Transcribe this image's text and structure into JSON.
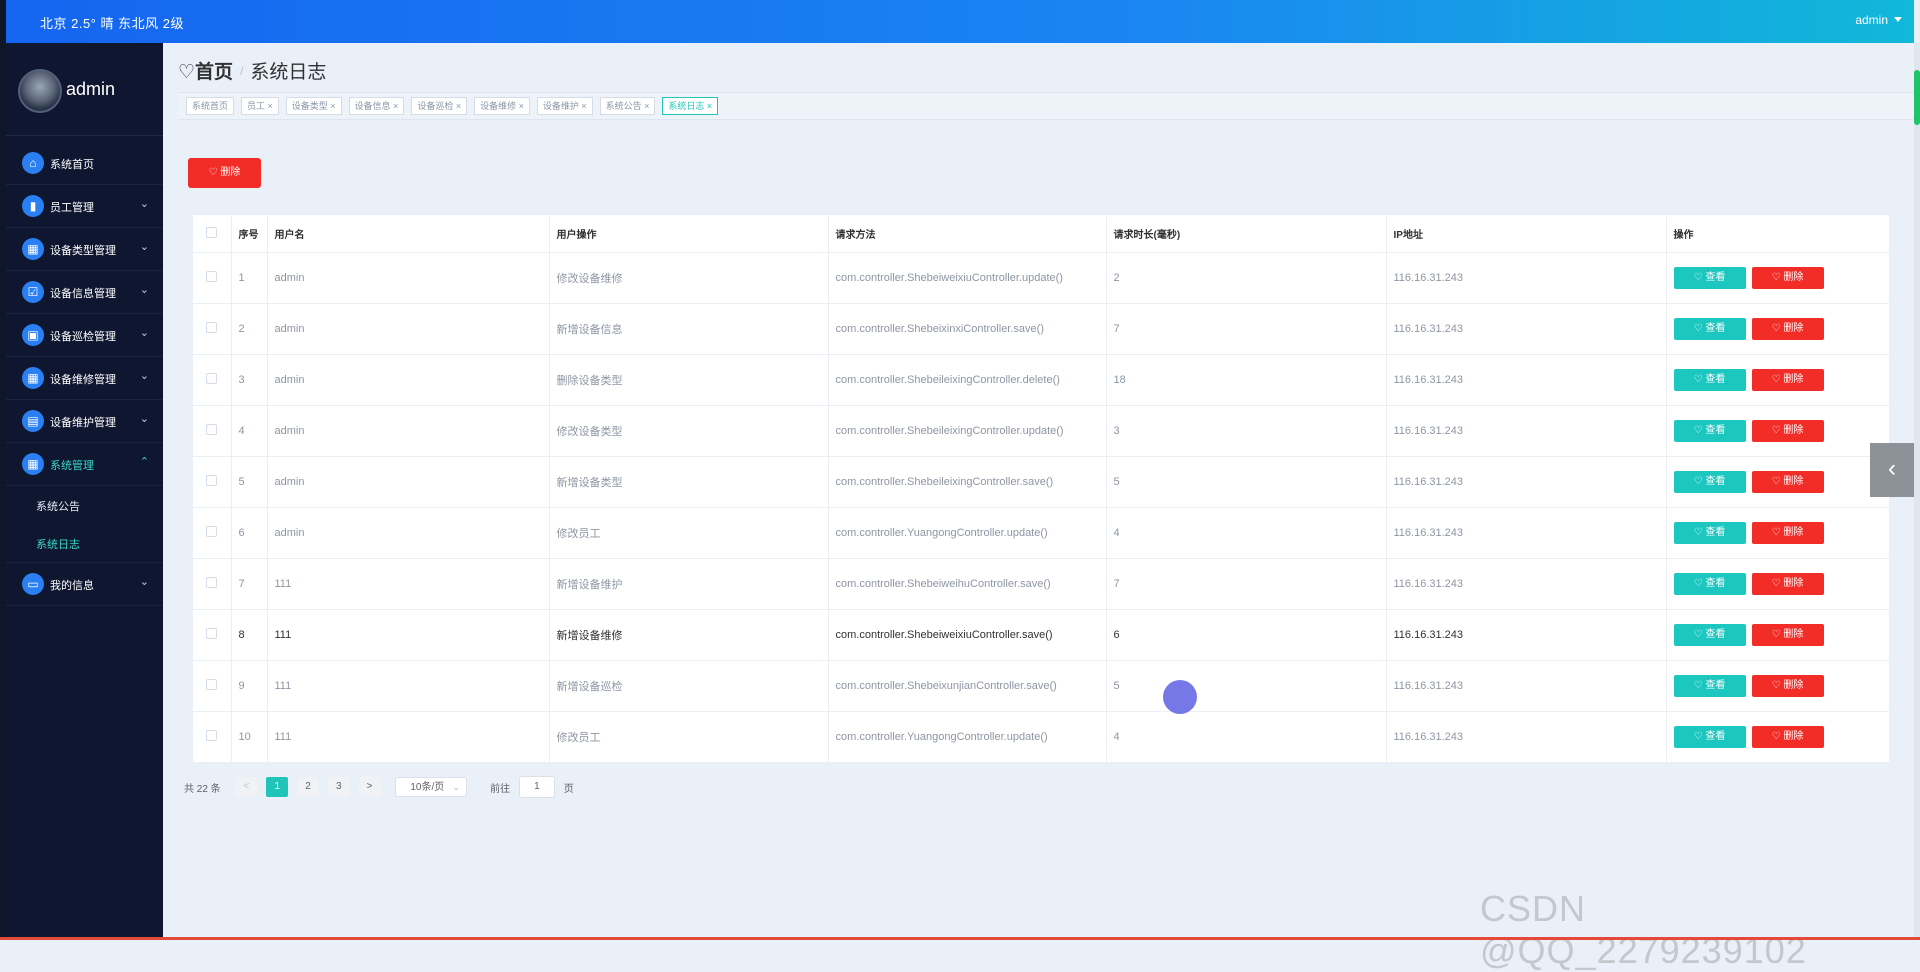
{
  "topbar": {
    "weather": "北京 2.5° 晴 东北风 2级",
    "user": "admin"
  },
  "sidebar": {
    "profile_name": "admin",
    "items": [
      {
        "label": "系统首页",
        "icon": "home-icon",
        "chev": ""
      },
      {
        "label": "员工管理",
        "icon": "chart-icon",
        "chev": "⌄"
      },
      {
        "label": "设备类型管理",
        "icon": "grid-icon",
        "chev": "⌄"
      },
      {
        "label": "设备信息管理",
        "icon": "checklist-icon",
        "chev": "⌄"
      },
      {
        "label": "设备巡检管理",
        "icon": "bag-icon",
        "chev": "⌄"
      },
      {
        "label": "设备维修管理",
        "icon": "grid-icon",
        "chev": "⌄"
      },
      {
        "label": "设备维护管理",
        "icon": "briefcase-icon",
        "chev": "⌄"
      },
      {
        "label": "系统管理",
        "icon": "grid-icon",
        "chev": "⌃"
      },
      {
        "label": "我的信息",
        "icon": "card-icon",
        "chev": "⌄"
      }
    ],
    "sub": [
      "系统公告",
      "系统日志"
    ]
  },
  "breadcrumb": {
    "home": "首页",
    "sep": "/",
    "current": "系统日志"
  },
  "tags": [
    "系统首页",
    "员工 ×",
    "设备类型 ×",
    "设备信息 ×",
    "设备巡检 ×",
    "设备维修 ×",
    "设备维护 ×",
    "系统公告 ×",
    "系统日志 ×"
  ],
  "delete_label": "♡ 删除",
  "table": {
    "headers": [
      "序号",
      "用户名",
      "用户操作",
      "请求方法",
      "请求时长(毫秒)",
      "IP地址",
      "操作"
    ],
    "view_label": "♡ 查看",
    "del_label": "♡ 删除",
    "rows": [
      [
        "1",
        "admin",
        "修改设备维修",
        "com.controller.ShebeiweixiuController.update()",
        "2",
        "116.16.31.243"
      ],
      [
        "2",
        "admin",
        "新增设备信息",
        "com.controller.ShebeixinxiController.save()",
        "7",
        "116.16.31.243"
      ],
      [
        "3",
        "admin",
        "删除设备类型",
        "com.controller.ShebeileixingController.delete()",
        "18",
        "116.16.31.243"
      ],
      [
        "4",
        "admin",
        "修改设备类型",
        "com.controller.ShebeileixingController.update()",
        "3",
        "116.16.31.243"
      ],
      [
        "5",
        "admin",
        "新增设备类型",
        "com.controller.ShebeileixingController.save()",
        "5",
        "116.16.31.243"
      ],
      [
        "6",
        "admin",
        "修改员工",
        "com.controller.YuangongController.update()",
        "4",
        "116.16.31.243"
      ],
      [
        "7",
        "111",
        "新增设备维护",
        "com.controller.ShebeiweihuController.save()",
        "7",
        "116.16.31.243"
      ],
      [
        "8",
        "111",
        "新增设备维修",
        "com.controller.ShebeiweixiuController.save()",
        "6",
        "116.16.31.243"
      ],
      [
        "9",
        "111",
        "新增设备巡检",
        "com.controller.ShebeixunjianController.save()",
        "5",
        "116.16.31.243"
      ],
      [
        "10",
        "111",
        "修改员工",
        "com.controller.YuangongController.update()",
        "4",
        "116.16.31.243"
      ]
    ]
  },
  "pager": {
    "total": "共 22 条",
    "prev": "<",
    "pages": [
      "1",
      "2",
      "3"
    ],
    "next": ">",
    "size": "10条/页",
    "goto": "前往",
    "page_value": "1",
    "page_suffix": "页"
  },
  "watermark": "CSDN @QQ_2279239102"
}
